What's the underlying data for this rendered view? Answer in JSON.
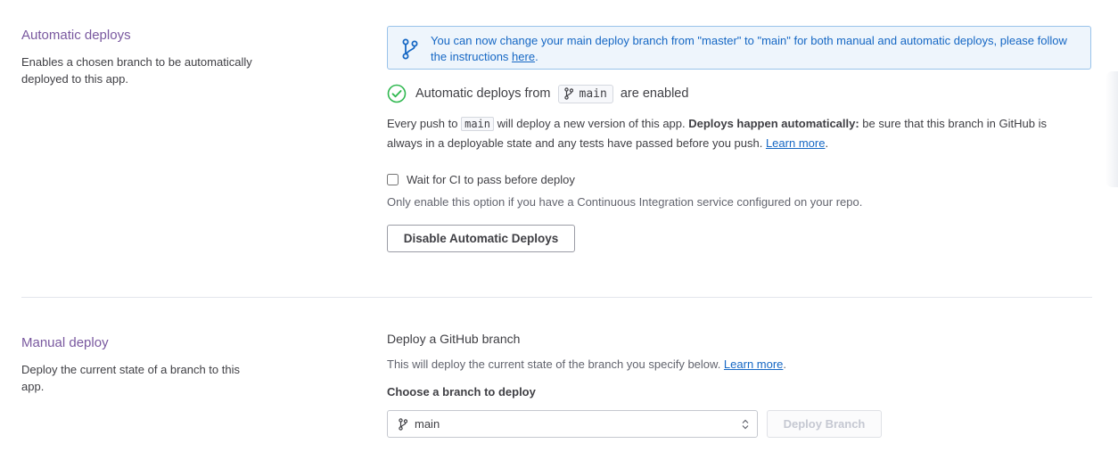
{
  "automatic": {
    "title": "Automatic deploys",
    "description": "Enables a chosen branch to be automatically deployed to this app.",
    "notice": {
      "text": "You can now change your main deploy branch from \"master\" to \"main\" for both manual and automatic deploys, please follow the instructions ",
      "link": "here",
      "tail": "."
    },
    "status": {
      "prefix": "Automatic deploys from",
      "branch": "main",
      "suffix": "are enabled"
    },
    "push_info": {
      "p1": "Every push to ",
      "branch": "main",
      "p2": " will deploy a new version of this app. ",
      "bold": "Deploys happen automatically:",
      "p3": " be sure that this branch in GitHub is always in a deployable state and any tests have passed before you push. ",
      "link": "Learn more",
      "tail": "."
    },
    "ci_checkbox_label": "Wait for CI to pass before deploy",
    "ci_checked": false,
    "ci_hint": "Only enable this option if you have a Continuous Integration service configured on your repo.",
    "disable_button": "Disable Automatic Deploys"
  },
  "manual": {
    "title": "Manual deploy",
    "description": "Deploy the current state of a branch to this app.",
    "subheading": "Deploy a GitHub branch",
    "info": "This will deploy the current state of the branch you specify below. ",
    "info_link": "Learn more",
    "info_tail": ".",
    "choose_label": "Choose a branch to deploy",
    "selected_branch": "main",
    "deploy_button": "Deploy Branch"
  },
  "colors": {
    "accent_purple": "#79589f",
    "link_blue": "#1567c4",
    "success_green": "#2fb84f",
    "notice_bg": "#eef5fc"
  },
  "icons": {
    "branch": "branch-icon",
    "check": "check-circle-icon",
    "select_arrows": "chevron-updown-icon"
  }
}
